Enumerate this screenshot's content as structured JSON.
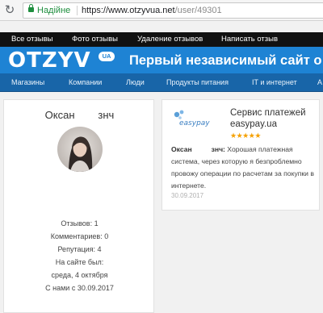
{
  "browser": {
    "secure_label": "Надійне",
    "url_main": "https://www.otzyvua.net",
    "url_path": "/user/49301"
  },
  "top_menu": [
    "Все отзывы",
    "Фото отзывы",
    "Удаление отзывов",
    "Написать отзыв"
  ],
  "brand": {
    "logo": "OTZYV",
    "logo_badge": "UA",
    "slogan": "Первый независимый сайт о"
  },
  "categories": [
    "Магазины",
    "Компании",
    "Люди",
    "Продукты питания",
    "IT и интернет"
  ],
  "profile": {
    "name": "Оксан        знч",
    "stats": [
      "Отзывов: 1",
      "Комментариев: 0",
      "Репутация: 4",
      "На сайте был:",
      "среда, 4 октября",
      "С нами с 30.09.2017"
    ]
  },
  "review": {
    "company": "Сервис платежей easypay.ua",
    "logo_text": "easypay",
    "rating": 5,
    "author": "Оксан          знч:",
    "text": " Хорошая платежная система, через которую я безпроблемно провожу операции по расчетам за покупки в интернете.",
    "date": "30.09.2017"
  },
  "colors": {
    "brand_blue": "#1e83d4",
    "nav_blue": "#1865a8",
    "top_bar": "#111111",
    "star": "#f5a000",
    "secure_green": "#1e8e3e"
  }
}
